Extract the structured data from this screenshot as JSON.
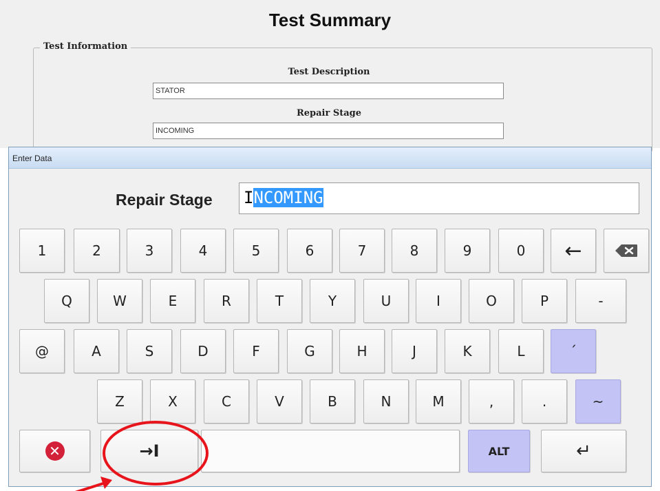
{
  "summary": {
    "title": "Test Summary",
    "group_title": "Test Information",
    "fields": [
      {
        "label": "Test Description",
        "value": "STATOR"
      },
      {
        "label": "Repair Stage",
        "value": "INCOMING"
      }
    ]
  },
  "dialog": {
    "title": "Enter Data",
    "field_label": "Repair Stage",
    "value_unselected": "I",
    "value_selected": "NCOMING"
  },
  "keyboard": {
    "row1": [
      "1",
      "2",
      "3",
      "4",
      "5",
      "6",
      "7",
      "8",
      "9",
      "0"
    ],
    "left_arrow": "←",
    "row2": [
      "Q",
      "W",
      "E",
      "R",
      "T",
      "Y",
      "U",
      "I",
      "O",
      "P",
      "-"
    ],
    "row3": [
      "@",
      "A",
      "S",
      "D",
      "F",
      "G",
      "H",
      "J",
      "K",
      "L",
      "´"
    ],
    "row4": [
      "Z",
      "X",
      "C",
      "V",
      "B",
      "N",
      "M",
      ",",
      ".",
      "~"
    ],
    "tab_key": "→I",
    "alt_key": "ALT",
    "enter_key": "↵",
    "icons": {
      "cancel": "cancel-icon",
      "backspace": "backspace-icon",
      "tab": "tab-icon",
      "enter": "enter-icon"
    }
  },
  "colors": {
    "selection": "#3399ff",
    "alt_keys": "#c3c3f5",
    "annotation": "#e8141c",
    "cancel": "#d4213a"
  }
}
